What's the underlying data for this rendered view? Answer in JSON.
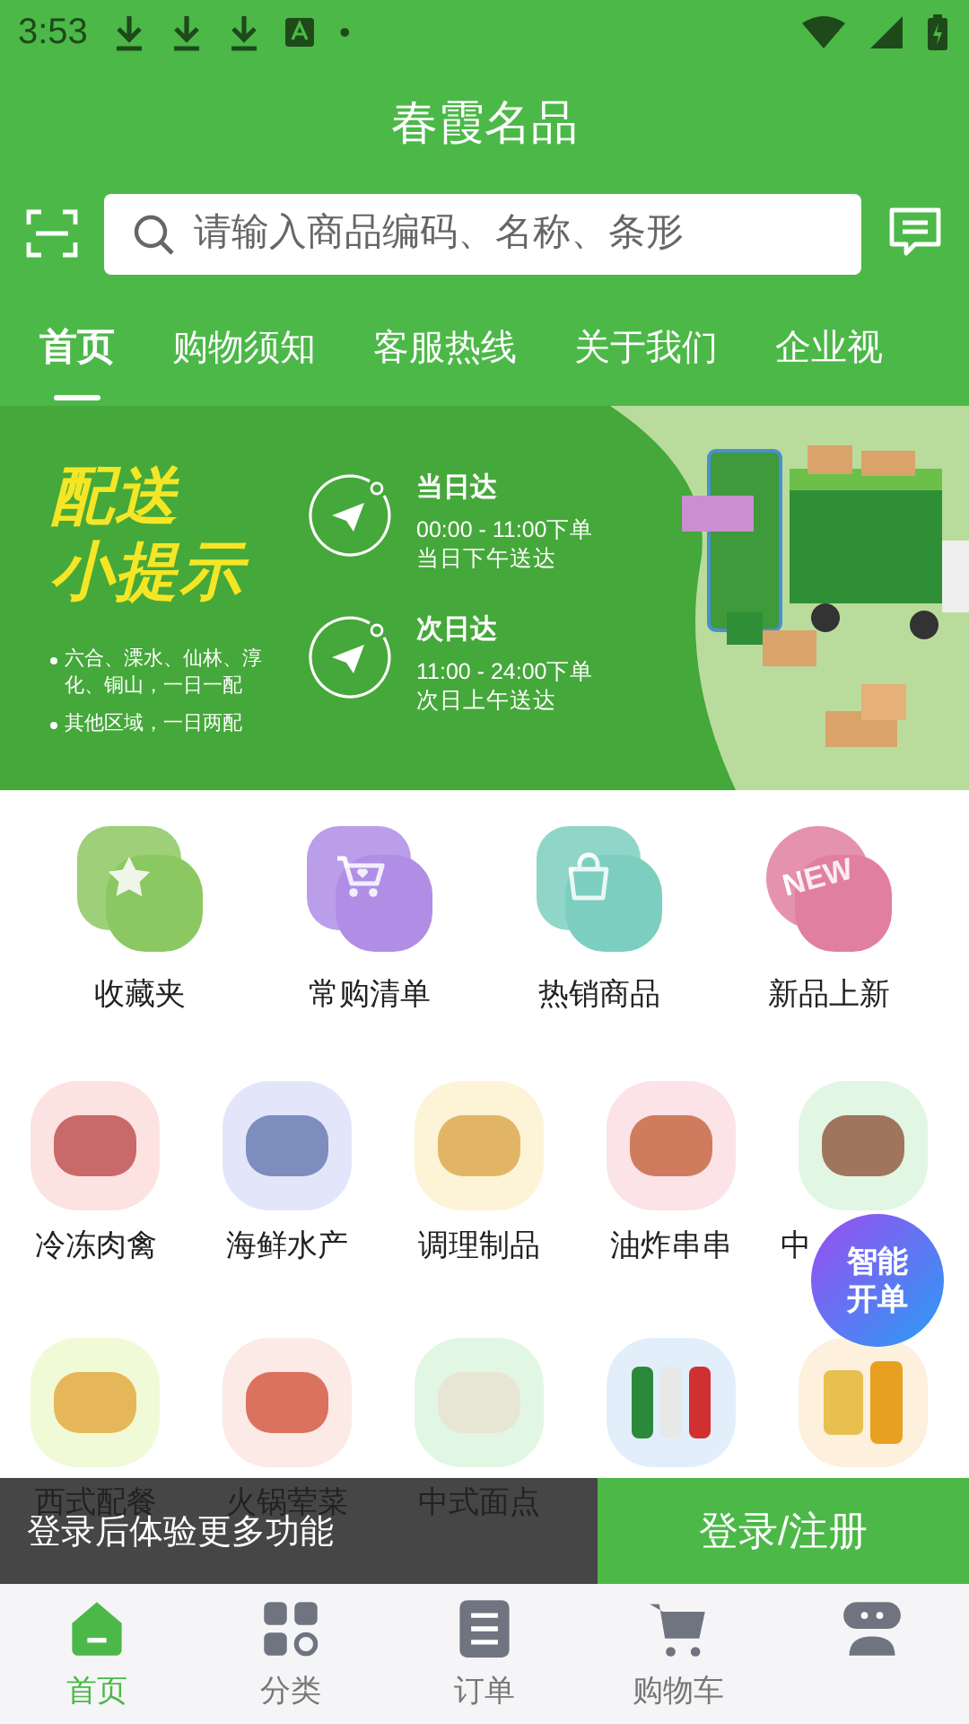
{
  "status_bar": {
    "time": "3:53",
    "notification_text": "•"
  },
  "header": {
    "title": "春霞名品",
    "search": {
      "placeholder": "请输入商品编码、名称、条形"
    }
  },
  "tabs": [
    {
      "label": "首页",
      "selected": true
    },
    {
      "label": "购物须知",
      "selected": false
    },
    {
      "label": "客服热线",
      "selected": false
    },
    {
      "label": "关于我们",
      "selected": false
    },
    {
      "label": "企业视",
      "selected": false
    }
  ],
  "banner": {
    "headline_1": "配送",
    "headline_2": "小提示",
    "notes": [
      "六合、溧水、仙林、淳化、铜山，一日一配",
      "其他区域，一日两配"
    ],
    "options": [
      {
        "title": "当日达",
        "line_1": "00:00 - 11:00下单",
        "line_2": "当日下午送达"
      },
      {
        "title": "次日达",
        "line_1": "11:00 - 24:00下单",
        "line_2": "次日上午送达"
      }
    ]
  },
  "shortcuts": [
    {
      "label": "收藏夹",
      "kind": "star",
      "color": "#8cc861"
    },
    {
      "label": "常购清单",
      "kind": "cart",
      "color": "#b08ee6"
    },
    {
      "label": "热销商品",
      "kind": "bag",
      "color": "#7ccfc0"
    },
    {
      "label": "新品上新",
      "kind": "new",
      "color": "#e07fa0",
      "badge": "NEW"
    }
  ],
  "categories": [
    {
      "kind": "food",
      "label": "冷冻肉禽"
    },
    {
      "kind": "food",
      "label": "海鲜水产"
    },
    {
      "kind": "food",
      "label": "调理制品"
    },
    {
      "kind": "food",
      "label": "油炸串串"
    },
    {
      "kind": "food",
      "label": "中"
    },
    {
      "kind": "food",
      "label": "西式配餐"
    },
    {
      "kind": "food",
      "label": "火锅荤菜"
    },
    {
      "kind": "food",
      "label": "中式面点"
    },
    {
      "kind": "drinks"
    },
    {
      "kind": "groceries"
    }
  ],
  "float_button": {
    "label": "智能开单"
  },
  "login_bar": {
    "message": "登录后体验更多功能",
    "button": "登录/注册"
  },
  "bottom_nav": [
    {
      "label": "首页",
      "kind": "home",
      "selected": true
    },
    {
      "label": "分类",
      "kind": "grid",
      "selected": false
    },
    {
      "label": "订单",
      "kind": "list",
      "selected": false
    },
    {
      "label": "购物车",
      "kind": "cart",
      "selected": false
    },
    {
      "kind": "chat",
      "selected": false
    }
  ]
}
